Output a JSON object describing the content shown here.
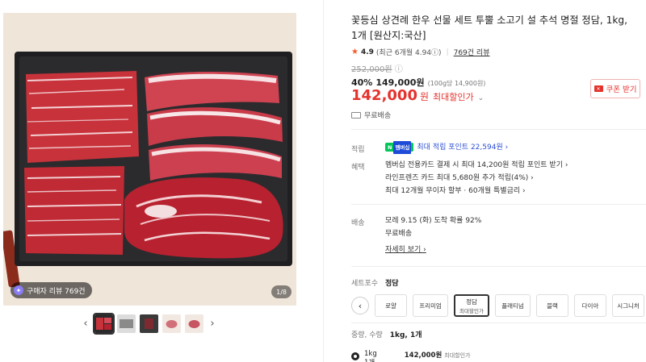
{
  "gallery": {
    "review_badge": "구매자 리뷰 769건",
    "page_indicator": "1/8",
    "prev_glyph": "‹",
    "next_glyph": "›"
  },
  "product": {
    "title": "꽃등심 상견례 한우 선물 세트 투뿔 소고기 설 추석 명절 정담, 1kg, 1개 [원산지:국산]",
    "rating_score": "4.9",
    "rating_recent": "(최근 6개월 4.94ⓘ)",
    "review_link": "769건 리뷰",
    "original_price": "252,000원",
    "original_info": "ⓘ",
    "discount_rate": "40%",
    "discount_price": "149,000원",
    "unit_price": "(100g당 14,900원)",
    "final_price": "142,000",
    "final_won": "원",
    "final_tag": "최대할인가",
    "final_chevron": "⌄",
    "coupon_label": "쿠폰 받기",
    "shipping_top": "무료배송"
  },
  "benefits": {
    "point_label": "적립",
    "npay_badge": "N",
    "npay_membership": "멤버십",
    "point_text": "최대 적립 포인트 22,594원 ›",
    "benefit_label": "혜택",
    "benefit_lines": [
      "멤버십 전용카드 결제 시 최대 14,200원 적립 포인트 받기 ›",
      "라인프렌즈 카드 최대 5,680원 추가 적립(4%) ›",
      "최대 12개월 무이자 할부 · 60개월 특별금리 ›"
    ]
  },
  "delivery": {
    "label": "배송",
    "eta": "모레 9.15 (화) 도착 확률 92%",
    "free": "무료배송",
    "more": "자세히 보기 ›"
  },
  "options": {
    "label": "세트포수",
    "selected_value": "정담",
    "prev": "‹",
    "next": "›",
    "chips": [
      {
        "label": "로얄",
        "sub": ""
      },
      {
        "label": "프리미엄",
        "sub": ""
      },
      {
        "label": "정담",
        "sub": "최대할인가"
      },
      {
        "label": "플래티넘",
        "sub": ""
      },
      {
        "label": "블랙",
        "sub": ""
      },
      {
        "label": "다이아",
        "sub": ""
      },
      {
        "label": "시그니처",
        "sub": ""
      }
    ]
  },
  "quantity": {
    "label": "중량, 수량",
    "selected_value": "1kg, 1개",
    "row_weight": "1kg",
    "row_count": "1개",
    "row_price": "142,000원",
    "row_tag": "최대할인가"
  },
  "colors": {
    "accent_red": "#e5322d",
    "star": "#f25b2a",
    "npay_green": "#03c75a",
    "point_blue": "#2d4fd4"
  }
}
